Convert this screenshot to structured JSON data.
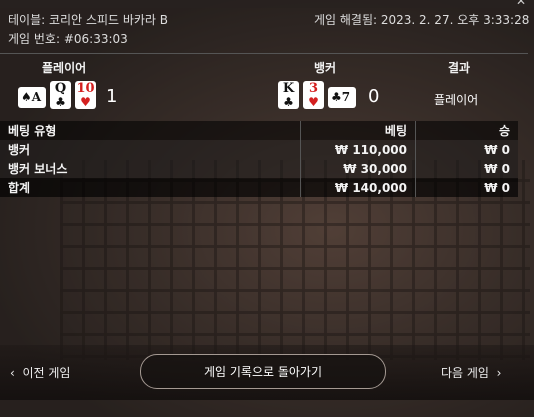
{
  "header": {
    "table_label": "테이블: 코리안 스피드 바카라 B",
    "game_number_label": "게임 번호: #06:33:03",
    "settled_label": "게임 해결됨: 2023. 2. 27. 오후 3:33:28"
  },
  "columns": {
    "player": "플레이어",
    "banker": "뱅커",
    "result": "결과"
  },
  "player": {
    "cards": [
      {
        "rank": "A",
        "suit": "♠",
        "color": "black",
        "side": true
      },
      {
        "rank": "Q",
        "suit": "♣",
        "color": "black",
        "side": false
      },
      {
        "rank": "10",
        "suit": "♥",
        "color": "red",
        "side": false
      }
    ],
    "score": "1"
  },
  "banker": {
    "cards": [
      {
        "rank": "K",
        "suit": "♣",
        "color": "black",
        "side": false
      },
      {
        "rank": "3",
        "suit": "♥",
        "color": "red",
        "side": false
      },
      {
        "rank": "7",
        "suit": "♣",
        "color": "black",
        "side": true
      }
    ],
    "score": "0"
  },
  "result": "플레이어",
  "bets_table": {
    "headers": [
      "베팅 유형",
      "베팅",
      "승"
    ],
    "rows": [
      [
        "뱅커",
        "₩ 110,000",
        "₩ 0"
      ],
      [
        "뱅커 보너스",
        "₩ 30,000",
        "₩ 0"
      ]
    ],
    "total": [
      "합계",
      "₩ 140,000",
      "₩ 0"
    ]
  },
  "footer": {
    "prev": "이전 게임",
    "back": "게임 기록으로 돌아가기",
    "next": "다음 게임"
  },
  "icons": {
    "prev": "chevron-left-icon",
    "next": "chevron-right-icon",
    "close": "close-icon"
  }
}
